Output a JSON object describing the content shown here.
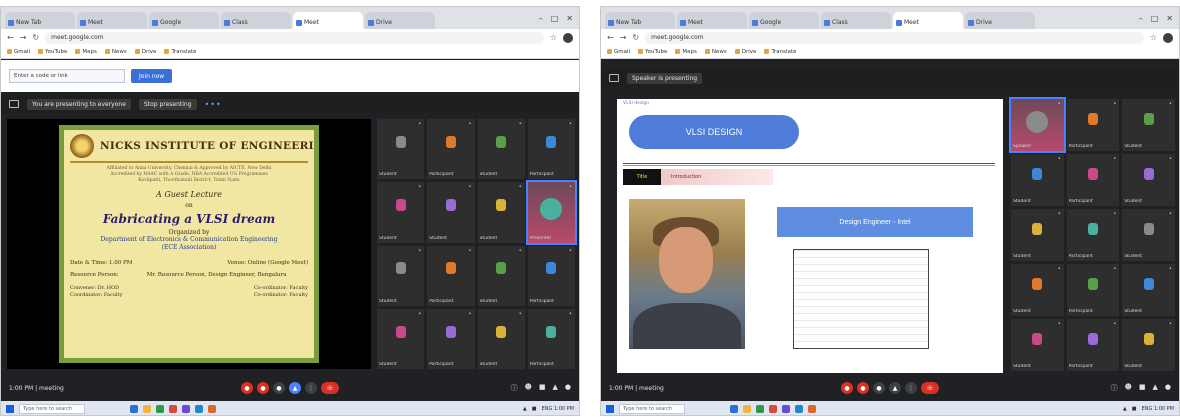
{
  "left": {
    "browser": {
      "tabs": [
        "New Tab",
        "Meet",
        "Google",
        "Class",
        "Meet",
        "Drive"
      ],
      "active_tab": 4,
      "url": "meet.google.com",
      "bookmarks": [
        "Gmail",
        "YouTube",
        "Maps",
        "News",
        "Drive",
        "Translate"
      ]
    },
    "join": {
      "input": "Enter a code or link",
      "button": "Join now",
      "note": ""
    },
    "meeting": {
      "presenter_chip": "You are presenting to everyone",
      "stop_chip": "Stop presenting",
      "right_label": ""
    },
    "brochure": {
      "institute": "NICKS INSTITUTE OF ENGINEERING",
      "address_lines": [
        "Affiliated to Anna University, Chennai & Approved by AICTE, New Delhi",
        "Accredited by NAAC with A Grade, NBA Accredited UG Programmes",
        "Kovilpatti, Thoothukudi District, Tamil Nadu"
      ],
      "event_type": "A Guest Lecture",
      "on": "on",
      "title": "Fabricating a VLSI dream",
      "organized_by": "Organized by",
      "department": "Department of Electronics & Communication Engineering",
      "department_sub": "(ECE Association)",
      "date_label": "Date & Time: 1.00 PM",
      "venue_label": "Venue: Online (Google Meet)",
      "resource_label": "Resource Person:",
      "resource_person": "Mr. Resource Person, Design Engineer, Bengaluru",
      "coordinators": [
        "Convener: Dr. HOD",
        "Coordinator: Faculty"
      ],
      "coordinators_right": [
        "Co-ordinator: Faculty",
        "Co-ordinator: Faculty"
      ]
    },
    "participants": [
      "Student",
      "Participant",
      "Student",
      "Participant",
      "Student",
      "Student",
      "Student",
      "Presenter",
      "Student",
      "Participant",
      "Student",
      "Participant",
      "Student",
      "Participant",
      "Student",
      "Participant"
    ],
    "controls": {
      "time": "1:00 PM | meeting"
    },
    "taskbar": {
      "search": "Type here to search",
      "tray": "ENG 1:00 PM"
    }
  },
  "right": {
    "browser": {
      "tabs": [
        "New Tab",
        "Meet",
        "Google",
        "Class",
        "Meet",
        "Drive"
      ],
      "active_tab": 4,
      "url": "meet.google.com",
      "bookmarks": [
        "Gmail",
        "YouTube",
        "Maps",
        "News",
        "Drive",
        "Translate"
      ]
    },
    "meeting": {
      "presenter_chip": "Speaker is presenting",
      "stop_chip": "",
      "right_label": ""
    },
    "slide": {
      "small": "VLSI design",
      "chip": "VLSI DESIGN",
      "band_key": "Title",
      "band_value": "Introduction",
      "name_block": "Design Engineer - Intel"
    },
    "participants": [
      "Speaker",
      "Participant",
      "Student",
      "Student",
      "Participant",
      "Student",
      "Student",
      "Participant",
      "Student",
      "Student",
      "Participant",
      "Student",
      "Student",
      "Participant",
      "Student"
    ],
    "controls": {
      "time": "1:00 PM | meeting"
    },
    "taskbar": {
      "search": "Type here to search",
      "tray": "ENG 1:00 PM"
    }
  },
  "colors": {
    "meet_bg": "#202124",
    "accent": "#4a82ff",
    "end_call": "#d93025",
    "brochure_bg": "#f2e6a3",
    "brochure_border": "#7a9c3b",
    "slide_chip": "#4f7bd9"
  },
  "icons": [
    "back-arrow-icon",
    "forward-arrow-icon",
    "reload-icon",
    "mic-icon",
    "camera-icon",
    "present-icon",
    "end-call-icon",
    "info-icon",
    "people-icon",
    "chat-icon",
    "windows-start-icon"
  ]
}
